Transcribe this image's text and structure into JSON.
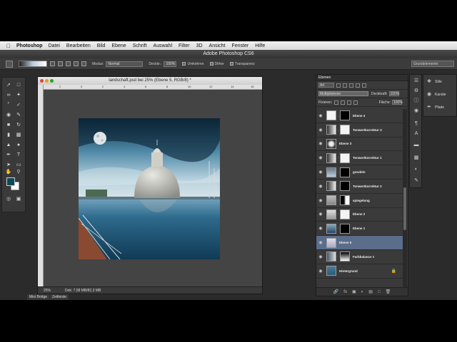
{
  "menubar": {
    "app_name": "Photoshop",
    "items": [
      "Datei",
      "Bearbeiten",
      "Bild",
      "Ebene",
      "Schrift",
      "Auswahl",
      "Filter",
      "3D",
      "Ansicht",
      "Fenster",
      "Hilfe"
    ]
  },
  "titlebar": {
    "title": "Adobe Photoshop CS6"
  },
  "optionsbar": {
    "mode_label": "Modus:",
    "mode_value": "Normal",
    "opacity_label": "Deckkr.:",
    "opacity_value": "100%",
    "reverse_label": "Umkehren",
    "dither_label": "Dither",
    "transparency_label": "Transparenz",
    "workspace": "Grundelemente"
  },
  "document": {
    "title": "landschaft.psd bei 25% (Ebene 5, RGB/8) *",
    "ruler_ticks": [
      "2",
      "0",
      "2",
      "4",
      "6",
      "8",
      "10",
      "12",
      "14",
      "16"
    ],
    "zoom": "25%",
    "info": "Dok: 7,58 MB/82,3 MB"
  },
  "bottom_tabs": [
    "Mini Bridge",
    "Zeitleiste"
  ],
  "layers_panel": {
    "tab": "Ebenen",
    "filter_type": "Art",
    "blend_mode": "Multiplizieren",
    "opacity_label": "Deckkraft:",
    "opacity_value": "100%",
    "lock_label": "Fixieren:",
    "fill_label": "Fläche:",
    "fill_value": "100%",
    "layers": [
      {
        "name": "Ebene 4",
        "thumb": "white",
        "mask": "black"
      },
      {
        "name": "Tonwertkorrektur 3",
        "thumb": "adjust",
        "mask": "white"
      },
      {
        "name": "Ebene 3",
        "thumb": "moon",
        "mask": ""
      },
      {
        "name": "Tonwertkorrektur 1",
        "thumb": "adjust",
        "mask": "white"
      },
      {
        "name": "gondeln",
        "thumb": "sky",
        "mask": "black"
      },
      {
        "name": "Tonwertkorrektur 2",
        "thumb": "adjust",
        "mask": "black"
      },
      {
        "name": "spiegelung",
        "thumb": "reflect",
        "mask": "mixed"
      },
      {
        "name": "Ebene 2",
        "thumb": "building",
        "mask": "white"
      },
      {
        "name": "Ebene 1",
        "thumb": "sea",
        "mask": "black"
      },
      {
        "name": "Ebene 5",
        "thumb": "light",
        "mask": "",
        "selected": true
      },
      {
        "name": "Farbbalance 1",
        "thumb": "balance",
        "mask": "gradient"
      },
      {
        "name": "Hintergrund",
        "thumb": "bg",
        "mask": "",
        "locked": true
      }
    ]
  },
  "right_panel": {
    "items": [
      "Stile",
      "Kanäle",
      "Pfade"
    ]
  }
}
